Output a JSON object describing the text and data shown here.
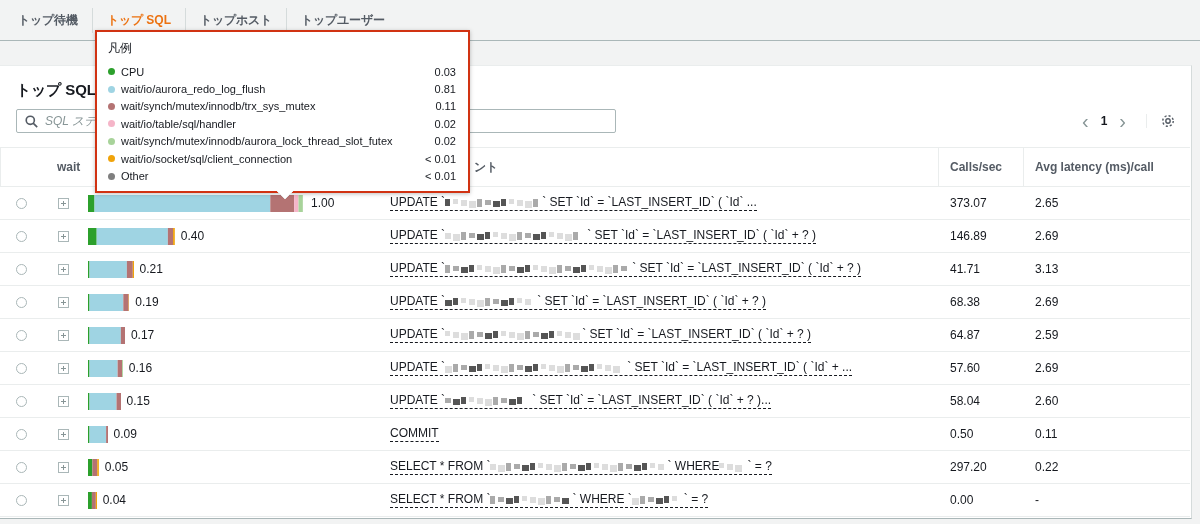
{
  "tabs": [
    {
      "label": "トップ待機",
      "selected": false
    },
    {
      "label": "トップ SQL",
      "selected": true
    },
    {
      "label": "トップホスト",
      "selected": false
    },
    {
      "label": "トップユーザー",
      "selected": false
    }
  ],
  "panel": {
    "title": "トップ SQL",
    "search": {
      "placeholder": "SQL ステ"
    },
    "pagination": {
      "prev": "‹",
      "page": "1",
      "next": "›"
    }
  },
  "table": {
    "columns": [
      "wait",
      "ント",
      "Calls/sec",
      "Avg latency (ms)/call"
    ],
    "rows": [
      {
        "selected": false,
        "load": "1.00",
        "sql": [
          "UPDATE `",
          "` SET `Id` = `LAST_INSERT_ID` ( `Id` ..."
        ],
        "calls": "373.07",
        "latency": "2.65"
      },
      {
        "selected": false,
        "load": "0.40",
        "sql": [
          "UPDATE `",
          "` SET `Id` = `LAST_INSERT_ID` ( `Id` + ? )"
        ],
        "calls": "146.89",
        "latency": "2.69"
      },
      {
        "selected": false,
        "load": "0.21",
        "sql": [
          "UPDATE `",
          "` SET `Id` = `LAST_INSERT_ID` ( `Id` + ? )"
        ],
        "calls": "41.71",
        "latency": "3.13"
      },
      {
        "selected": false,
        "load": "0.19",
        "sql": [
          "UPDATE `",
          "` SET `Id` = `LAST_INSERT_ID` ( `Id` + ? )"
        ],
        "calls": "68.38",
        "latency": "2.69"
      },
      {
        "selected": false,
        "load": "0.17",
        "sql": [
          "UPDATE `",
          "` SET `Id` = `LAST_INSERT_ID` ( `Id` + ? )"
        ],
        "calls": "64.87",
        "latency": "2.59"
      },
      {
        "selected": false,
        "load": "0.16",
        "sql": [
          "UPDATE `",
          "` SET `Id` = `LAST_INSERT_ID` ( `Id` + ..."
        ],
        "calls": "57.60",
        "latency": "2.69"
      },
      {
        "selected": false,
        "load": "0.15",
        "sql": [
          "UPDATE `",
          "` SET `Id` = `LAST_INSERT_ID` ( `Id` + ? )..."
        ],
        "calls": "58.04",
        "latency": "2.60"
      },
      {
        "selected": false,
        "load": "0.09",
        "sql": [
          "COMMIT"
        ],
        "calls": "0.50",
        "latency": "0.11"
      },
      {
        "selected": false,
        "load": "0.05",
        "sql": [
          "SELECT * FROM `",
          "` WHERE",
          "` = ?"
        ],
        "calls": "297.20",
        "latency": "0.22"
      },
      {
        "selected": false,
        "load": "0.04",
        "sql": [
          "SELECT * FROM `",
          "` WHERE `",
          "` = ?"
        ],
        "calls": "0.00",
        "latency": "-"
      }
    ]
  },
  "legend": {
    "title": "凡例",
    "items": [
      {
        "label": "CPU",
        "value": "0.03",
        "color": "#2ca02c"
      },
      {
        "label": "wait/io/aurora_redo_log_flush",
        "value": "0.81",
        "color": "#9fd4e3"
      },
      {
        "label": "wait/synch/mutex/innodb/trx_sys_mutex",
        "value": "0.11",
        "color": "#b47373"
      },
      {
        "label": "wait/io/table/sql/handler",
        "value": "0.02",
        "color": "#f5b5c8"
      },
      {
        "label": "wait/synch/mutex/innodb/aurora_lock_thread_slot_futex",
        "value": "0.02",
        "color": "#a8d39a"
      },
      {
        "label": "wait/io/socket/sql/client_connection",
        "value": "< 0.01",
        "color": "#f0a30a"
      },
      {
        "label": "Other",
        "value": "< 0.01",
        "color": "#7f7f7f"
      }
    ]
  }
}
